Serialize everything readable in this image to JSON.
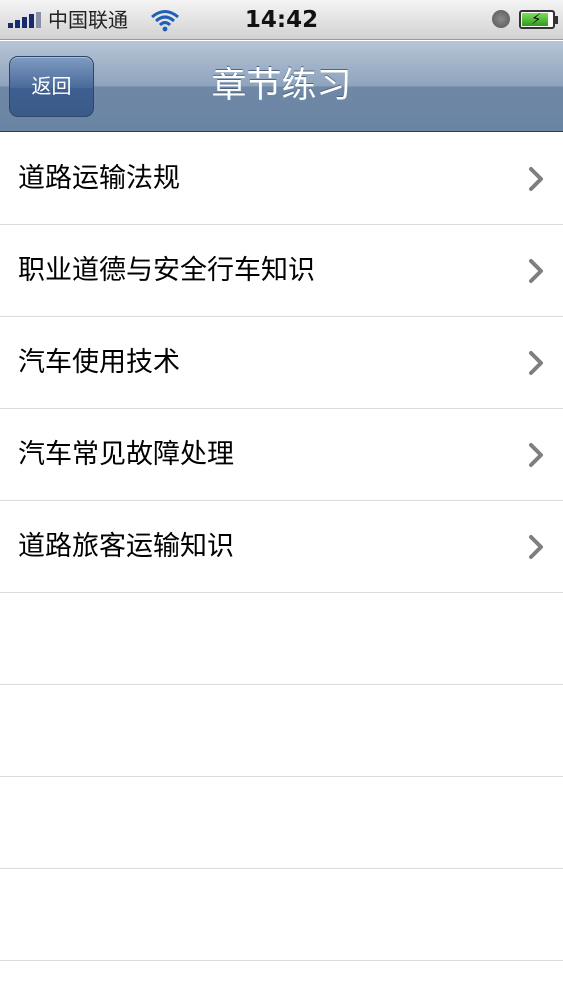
{
  "status_bar": {
    "carrier": "中国联通",
    "time": "14:42",
    "signal_icon": "signal-bars-icon",
    "wifi_icon": "wifi-icon",
    "orientation_icon": "orientation-lock-icon",
    "battery_icon": "battery-charging-icon",
    "battery_level": 0.85
  },
  "nav_bar": {
    "back_label": "返回",
    "title": "章节练习"
  },
  "list": {
    "items": [
      {
        "label": "道路运输法规"
      },
      {
        "label": "职业道德与安全行车知识"
      },
      {
        "label": "汽车使用技术"
      },
      {
        "label": "汽车常见故障处理"
      },
      {
        "label": "道路旅客运输知识"
      }
    ],
    "chevron_icon": "chevron-right-icon",
    "empty_rows": 4
  },
  "colors": {
    "nav_top": "#b7c5d6",
    "nav_bottom": "#6a84a3",
    "back_button": "#4a6b9a",
    "separator": "#dcdcdc",
    "chevron": "#7f7f7f"
  }
}
